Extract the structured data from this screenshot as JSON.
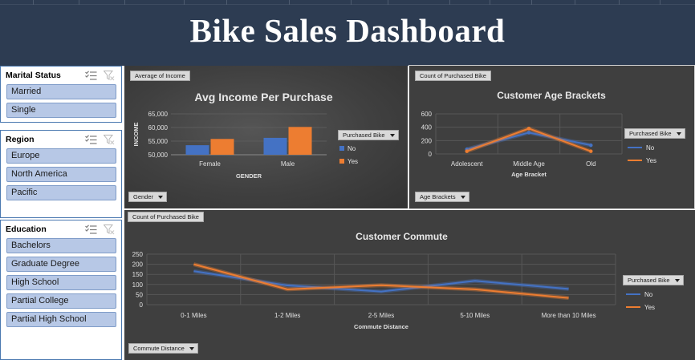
{
  "dashboard": {
    "title": "Bike Sales Dashboard"
  },
  "colors": {
    "no": "#4472c4",
    "yes": "#ed7d31",
    "banner": "#2d3c52",
    "panel": "#3f3f3f"
  },
  "slicers": [
    {
      "title": "Marital Status",
      "items": [
        "Married",
        "Single"
      ]
    },
    {
      "title": "Region",
      "items": [
        "Europe",
        "North America",
        "Pacific"
      ]
    },
    {
      "title": "Education",
      "items": [
        "Bachelors",
        "Graduate Degree",
        "High School",
        "Partial College",
        "Partial High School"
      ]
    }
  ],
  "slicer_icons": [
    "multi-select-icon",
    "clear-filter-icon"
  ],
  "legend": {
    "title": "Purchased Bike",
    "no": "No",
    "yes": "Yes"
  },
  "income_chart": {
    "field_value": "Average of Income",
    "field_axis": "Gender",
    "chart_data": {
      "type": "bar",
      "title": "Avg Income Per Purchase",
      "xlabel": "GENDER",
      "ylabel": "INCOME",
      "categories": [
        "Female",
        "Male"
      ],
      "yticks": [
        "50,000",
        "55,000",
        "60,000",
        "65,000"
      ],
      "ylim": [
        50000,
        65000
      ],
      "legend_title": "Purchased Bike",
      "series": [
        {
          "name": "No",
          "values": [
            53500,
            56200
          ]
        },
        {
          "name": "Yes",
          "values": [
            55800,
            60200
          ]
        }
      ]
    }
  },
  "age_chart": {
    "field_value": "Count of Purchased Bike",
    "field_axis": "Age Brackets",
    "chart_data": {
      "type": "line",
      "title": "Customer Age Brackets",
      "xlabel": "Age Bracket",
      "ylabel": "",
      "categories": [
        "Adolescent",
        "Middle Age",
        "Old"
      ],
      "yticks": [
        "0",
        "200",
        "400",
        "600"
      ],
      "ylim": [
        0,
        600
      ],
      "legend_title": "Purchased Bike",
      "series": [
        {
          "name": "No",
          "values": [
            70,
            320,
            130
          ]
        },
        {
          "name": "Yes",
          "values": [
            40,
            380,
            40
          ]
        }
      ]
    }
  },
  "commute_chart": {
    "field_value": "Count of Purchased Bike",
    "field_axis": "Commute Distance",
    "chart_data": {
      "type": "line",
      "title": "Customer Commute",
      "xlabel": "Commute Distance",
      "ylabel": "",
      "categories": [
        "0-1 Miles",
        "1-2 Miles",
        "2-5 Miles",
        "5-10 Miles",
        "More than 10 Miles"
      ],
      "yticks": [
        "0",
        "50",
        "100",
        "150",
        "200",
        "250"
      ],
      "ylim": [
        0,
        250
      ],
      "legend_title": "Purchased Bike",
      "series": [
        {
          "name": "No",
          "values": [
            166,
            95,
            65,
            118,
            78
          ]
        },
        {
          "name": "Yes",
          "values": [
            200,
            76,
            96,
            76,
            33
          ]
        }
      ]
    }
  }
}
